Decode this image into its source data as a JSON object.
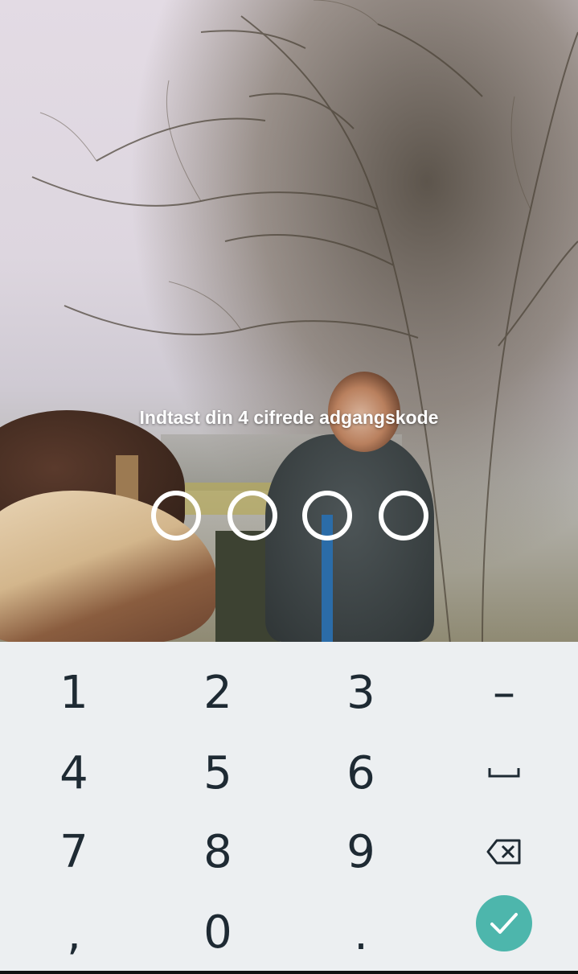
{
  "lock_screen": {
    "prompt": "Indtast din 4 cifrede adgangskode",
    "pin_length": 4,
    "entered_digits": 0
  },
  "keypad": {
    "row1": [
      "1",
      "2",
      "3",
      "–"
    ],
    "row2": [
      "4",
      "5",
      "6",
      "space-icon"
    ],
    "row3": [
      "7",
      "8",
      "9",
      "backspace-icon"
    ],
    "row4": [
      ",",
      "0",
      ".",
      "checkmark-icon"
    ],
    "keys": {
      "k1": "1",
      "k2": "2",
      "k3": "3",
      "dash": "–",
      "k4": "4",
      "k5": "5",
      "k6": "6",
      "k7": "7",
      "k8": "8",
      "k9": "9",
      "comma": ",",
      "k0": "0",
      "period": "."
    },
    "ok_color": "#4db6ac",
    "background_color": "#eceff1"
  }
}
